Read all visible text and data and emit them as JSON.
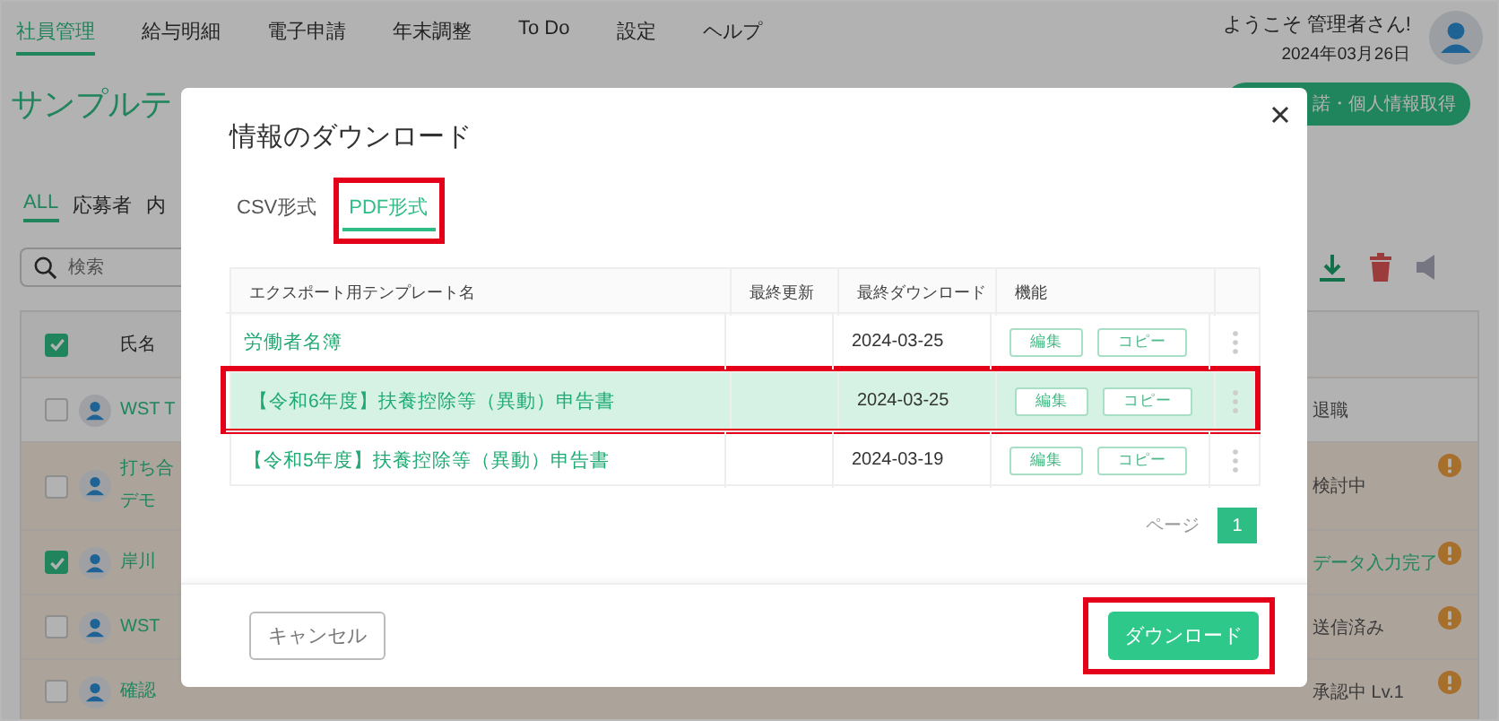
{
  "nav": {
    "items": [
      {
        "label": "社員管理",
        "selected": true
      },
      {
        "label": "給与明細",
        "selected": false
      },
      {
        "label": "電子申請",
        "selected": false
      },
      {
        "label": "年末調整",
        "selected": false
      },
      {
        "label": "To Do",
        "selected": false
      },
      {
        "label": "設定",
        "selected": false
      },
      {
        "label": "ヘルプ",
        "selected": false
      }
    ],
    "welcome": "ようこそ 管理者さん!",
    "date": "2024年03月26日"
  },
  "header": {
    "title": "サンプルテ",
    "action": "諾・個人情報取得"
  },
  "list_tabs": [
    {
      "label": "ALL",
      "selected": true
    },
    {
      "label": "応募者",
      "selected": false
    },
    {
      "label": "内",
      "selected": false
    }
  ],
  "search": {
    "placeholder": "検索"
  },
  "employees": {
    "header": {
      "name": "氏名",
      "checked": true
    },
    "rows": [
      {
        "name": [
          "WST T"
        ],
        "checked": false,
        "tinted": false,
        "status": "退職",
        "completed": false,
        "alert": false
      },
      {
        "name": [
          "打ち合",
          "デモ"
        ],
        "checked": false,
        "tinted": true,
        "status": "検討中",
        "completed": false,
        "alert": true
      },
      {
        "name": [
          "岸川"
        ],
        "checked": true,
        "tinted": true,
        "status": "データ入力完了",
        "completed": true,
        "alert": true
      },
      {
        "name": [
          "WST"
        ],
        "checked": false,
        "tinted": true,
        "status": "送信済み",
        "completed": false,
        "alert": true
      },
      {
        "name": [
          "確認"
        ],
        "checked": false,
        "tinted": true,
        "status": "承認中 Lv.1",
        "completed": false,
        "alert": true
      }
    ]
  },
  "dialog": {
    "title": "情報のダウンロード",
    "tabs": [
      {
        "label": "CSV形式",
        "selected": false,
        "highlighted": false
      },
      {
        "label": "PDF形式",
        "selected": true,
        "highlighted": true
      }
    ],
    "table": {
      "columns": [
        "エクスポート用テンプレート名",
        "最終更新",
        "最終ダウンロード",
        "機能"
      ],
      "rows": [
        {
          "name": "労働者名簿",
          "last_download": "2024-03-25",
          "actions": [
            "編集",
            "コピー"
          ],
          "selected": false,
          "highlighted": false
        },
        {
          "name": "【令和6年度】扶養控除等（異動）申告書",
          "last_download": "2024-03-25",
          "actions": [
            "編集",
            "コピー"
          ],
          "selected": true,
          "highlighted": true
        },
        {
          "name": "【令和5年度】扶養控除等（異動）申告書",
          "last_download": "2024-03-19",
          "actions": [
            "編集",
            "コピー"
          ],
          "selected": false,
          "highlighted": false
        }
      ]
    },
    "pagination": {
      "label": "ページ",
      "pages": [
        {
          "label": "1",
          "selected": true
        }
      ]
    },
    "buttons": [
      {
        "label": "キャンセル",
        "kind": "secondary",
        "highlighted": false
      },
      {
        "label": "ダウンロード",
        "kind": "primary",
        "highlighted": true
      }
    ]
  }
}
